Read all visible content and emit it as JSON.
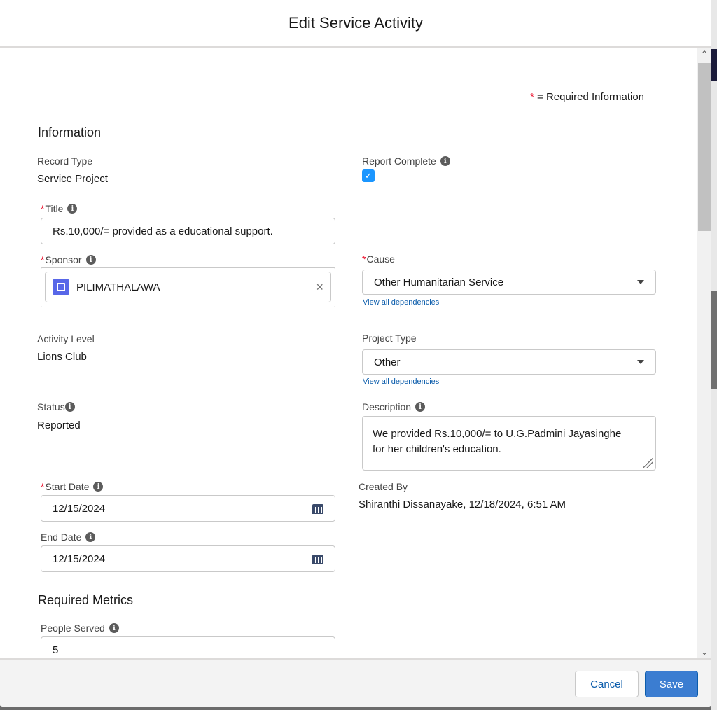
{
  "modal": {
    "title": "Edit Service Activity"
  },
  "required_note": {
    "star": "*",
    "text": "= Required Information"
  },
  "section_information": "Information",
  "record_type": {
    "label": "Record Type",
    "value": "Service Project"
  },
  "report_complete": {
    "label": "Report Complete",
    "checked": true
  },
  "title_field": {
    "label": "Title",
    "value": "Rs.10,000/= provided as a educational support."
  },
  "sponsor": {
    "label": "Sponsor",
    "value": "PILIMATHALAWA"
  },
  "cause": {
    "label": "Cause",
    "value": "Other Humanitarian Service",
    "link": "View all dependencies"
  },
  "activity_level": {
    "label": "Activity Level",
    "value": "Lions Club"
  },
  "project_type": {
    "label": "Project Type",
    "value": "Other",
    "link": "View all dependencies"
  },
  "status": {
    "label": "Status",
    "value": "Reported"
  },
  "description": {
    "label": "Description",
    "line1": "We provided Rs.10,000/= to U.G.Padmini Jayasinghe",
    "line2": "for her children's education."
  },
  "start_date": {
    "label": "Start Date",
    "value": "12/15/2024"
  },
  "created_by": {
    "label": "Created By",
    "value": "Shiranthi Dissanayake, 12/18/2024, 6:51 AM"
  },
  "end_date": {
    "label": "End Date",
    "value": "12/15/2024"
  },
  "section_metrics": "Required Metrics",
  "people_served": {
    "label": "People Served",
    "value": "5"
  },
  "footer": {
    "cancel": "Cancel",
    "save": "Save"
  },
  "icons": {
    "info": "i",
    "check": "✓",
    "close": "×",
    "scroll_up": "⌃",
    "scroll_down": "⌄"
  },
  "colors": {
    "primary": "#0b5cab",
    "required": "#ea001e",
    "checkbox": "#1b96ff",
    "sponsor_icon": "#5867e8"
  }
}
